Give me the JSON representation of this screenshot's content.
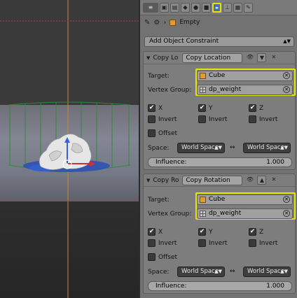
{
  "toolbar": {
    "tabs": [
      {
        "icon": "menu-icon",
        "glyph": "≡"
      },
      {
        "icon": "camera-icon",
        "glyph": "▣"
      },
      {
        "icon": "render-layers-icon",
        "glyph": "▤"
      },
      {
        "icon": "scene-icon",
        "glyph": "◆"
      },
      {
        "icon": "world-icon",
        "glyph": "●"
      },
      {
        "icon": "object-icon",
        "glyph": "■"
      },
      {
        "icon": "constraints-icon",
        "glyph": "⚭"
      },
      {
        "icon": "data-icon",
        "glyph": "⊥"
      },
      {
        "icon": "texture-icon",
        "glyph": "▦"
      },
      {
        "icon": "physics-icon",
        "glyph": "✎"
      }
    ],
    "active_tab": "constraints-icon"
  },
  "breadcrumb": {
    "pin_glyph": "✎",
    "object_name": "Empty"
  },
  "add_constraint_label": "Add Object Constraint",
  "constraints": [
    {
      "short_name": "Copy Lo",
      "name": "Copy Location",
      "target_label": "Target:",
      "target_value": "Cube",
      "vgroup_label": "Vertex Group:",
      "vgroup_value": "dp_weight",
      "axes": [
        {
          "label": "X",
          "checked": true
        },
        {
          "label": "Y",
          "checked": true
        },
        {
          "label": "Z",
          "checked": true
        }
      ],
      "invert_label": "Invert",
      "offset_label": "Offset",
      "space_label": "Space:",
      "owner_space": "World Space",
      "target_space": "World Space",
      "influence_label": "Influence:",
      "influence_value": "1.000"
    },
    {
      "short_name": "Copy Ro",
      "name": "Copy Rotation",
      "target_label": "Target:",
      "target_value": "Cube",
      "vgroup_label": "Vertex Group:",
      "vgroup_value": "dp_weight",
      "axes": [
        {
          "label": "X",
          "checked": true
        },
        {
          "label": "Y",
          "checked": true
        },
        {
          "label": "Z",
          "checked": true
        }
      ],
      "invert_label": "Invert",
      "offset_label": "Offset",
      "space_label": "Space:",
      "owner_space": "World Space",
      "target_space": "World Space",
      "influence_label": "Influence:",
      "influence_value": "1.000"
    }
  ],
  "colors": {
    "highlight": "#e6e600",
    "active_tab": "#4a6fb0",
    "cube_icon": "#e39b37"
  }
}
